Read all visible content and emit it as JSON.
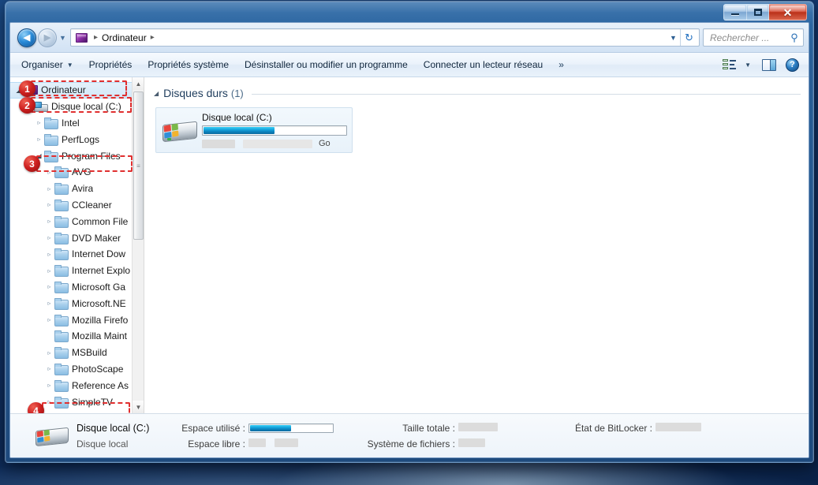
{
  "window": {
    "minimize_label": "–",
    "maximize_label": "□",
    "close_label": "✕"
  },
  "addressbar": {
    "back_glyph": "◀",
    "forward_glyph": "▶",
    "history_glyph": "▼",
    "computer_crumb": "Ordinateur",
    "crumb_sep": "▸",
    "dropdown_glyph": "▼",
    "refresh_glyph": "↻",
    "search_placeholder": "Rechercher ...",
    "search_value": "",
    "search_icon_glyph": "⚲"
  },
  "toolbar": {
    "items": [
      {
        "label": "Organiser",
        "has_caret": true
      },
      {
        "label": "Propriétés",
        "has_caret": false
      },
      {
        "label": "Propriétés système",
        "has_caret": false
      },
      {
        "label": "Désinstaller ou modifier un programme",
        "has_caret": false
      },
      {
        "label": "Connecter un lecteur réseau",
        "has_caret": false
      }
    ],
    "overflow_label": "»",
    "caret_glyph": "▼",
    "help_label": "?"
  },
  "sidebar": {
    "items": [
      {
        "label": "Ordinateur",
        "indent": 0,
        "expander": "open",
        "icon": "computer",
        "selected": true
      },
      {
        "label": "Disque local (C:)",
        "indent": 1,
        "expander": "open",
        "icon": "drive",
        "selected": false
      },
      {
        "label": "Intel",
        "indent": 2,
        "expander": "closed",
        "icon": "folder",
        "selected": false
      },
      {
        "label": "PerfLogs",
        "indent": 2,
        "expander": "closed",
        "icon": "folder",
        "selected": false
      },
      {
        "label": "Program Files",
        "indent": 2,
        "expander": "open",
        "icon": "folder",
        "selected": false
      },
      {
        "label": "AVG",
        "indent": 3,
        "expander": "closed",
        "icon": "folder",
        "selected": false
      },
      {
        "label": "Avira",
        "indent": 3,
        "expander": "closed",
        "icon": "folder",
        "selected": false
      },
      {
        "label": "CCleaner",
        "indent": 3,
        "expander": "closed",
        "icon": "folder",
        "selected": false
      },
      {
        "label": "Common File",
        "indent": 3,
        "expander": "closed",
        "icon": "folder",
        "selected": false
      },
      {
        "label": "DVD Maker",
        "indent": 3,
        "expander": "closed",
        "icon": "folder",
        "selected": false
      },
      {
        "label": "Internet Dow",
        "indent": 3,
        "expander": "closed",
        "icon": "folder",
        "selected": false
      },
      {
        "label": "Internet Explo",
        "indent": 3,
        "expander": "closed",
        "icon": "folder",
        "selected": false
      },
      {
        "label": "Microsoft Ga",
        "indent": 3,
        "expander": "closed",
        "icon": "folder",
        "selected": false
      },
      {
        "label": "Microsoft.NE",
        "indent": 3,
        "expander": "closed",
        "icon": "folder",
        "selected": false
      },
      {
        "label": "Mozilla Firefo",
        "indent": 3,
        "expander": "closed",
        "icon": "folder",
        "selected": false
      },
      {
        "label": "Mozilla Maint",
        "indent": 3,
        "expander": "none",
        "icon": "folder",
        "selected": false
      },
      {
        "label": "MSBuild",
        "indent": 3,
        "expander": "closed",
        "icon": "folder",
        "selected": false
      },
      {
        "label": "PhotoScape",
        "indent": 3,
        "expander": "closed",
        "icon": "folder",
        "selected": false
      },
      {
        "label": "Reference As",
        "indent": 3,
        "expander": "closed",
        "icon": "folder",
        "selected": false
      },
      {
        "label": "SimpleTV",
        "indent": 3,
        "expander": "closed",
        "icon": "folder",
        "selected": false
      }
    ],
    "expander_closed_glyph": "▹",
    "expander_open_glyph": "◢",
    "scroll_up_glyph": "▲",
    "scroll_down_glyph": "▼",
    "thumb_grip_glyph": "≡"
  },
  "annotations": [
    {
      "number": "1",
      "target": "Ordinateur"
    },
    {
      "number": "2",
      "target": "Disque local (C:)"
    },
    {
      "number": "3",
      "target": "Program Files"
    },
    {
      "number": "4",
      "target": "SimpleTV"
    }
  ],
  "content": {
    "group_title": "Disques durs",
    "group_count": "(1)",
    "group_tri_glyph": "◢",
    "drive": {
      "name": "Disque local (C:)",
      "used_percent": 50,
      "size_unit": "Go",
      "free_text_redacted": "",
      "total_text_redacted": ""
    }
  },
  "statusbar": {
    "drive_name": "Disque local (C:)",
    "drive_type": "Disque local",
    "used_label": "Espace utilisé :",
    "free_label": "Espace libre :",
    "total_label": "Taille totale :",
    "filesystem_label": "Système de fichiers :",
    "bitlocker_label": "État de BitLocker :",
    "used_percent": 50,
    "free_value_redacted": "",
    "total_value_redacted": "",
    "filesystem_value_redacted": "",
    "bitlocker_value_redacted": ""
  },
  "colors": {
    "accent_blue": "#16a8e0",
    "badge_red": "#cc1f1f",
    "dashed_red": "#e03030",
    "close_red": "#d6523c",
    "selection_blue": "#d3e8f8"
  }
}
